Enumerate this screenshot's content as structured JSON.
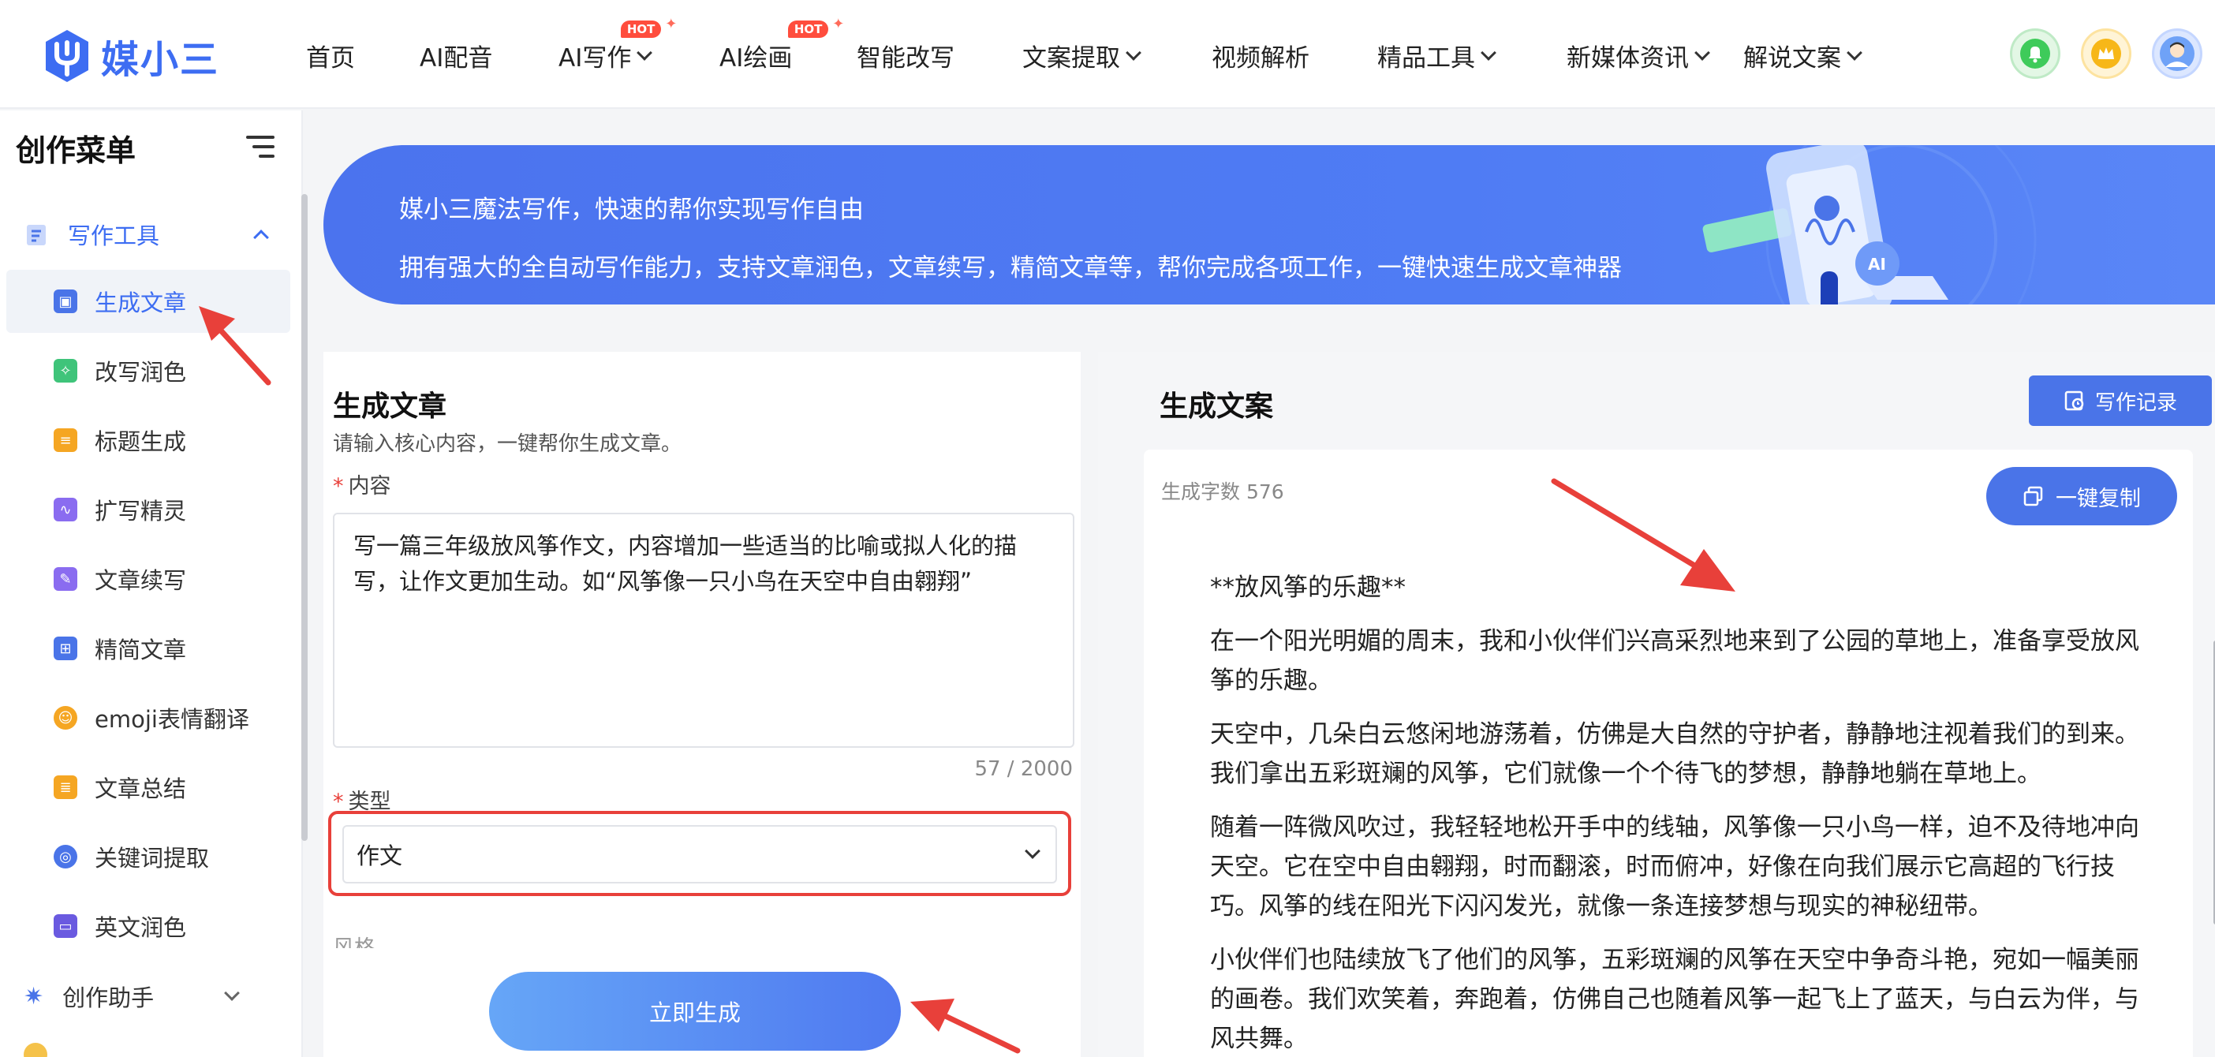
{
  "header": {
    "logo_text": "媒小三",
    "nav": [
      {
        "label": "首页"
      },
      {
        "label": "AI配音"
      },
      {
        "label": "AI写作",
        "dropdown": true,
        "badge": "HOT"
      },
      {
        "label": "AI绘画",
        "badge": "HOT"
      },
      {
        "label": "智能改写"
      },
      {
        "label": "文案提取",
        "dropdown": true
      },
      {
        "label": "视频解析"
      },
      {
        "label": "精品工具",
        "dropdown": true
      },
      {
        "label": "新媒体资讯",
        "dropdown": true
      },
      {
        "label": "解说文案",
        "dropdown": true
      }
    ],
    "icons": [
      "bell-icon",
      "crown-icon",
      "avatar"
    ]
  },
  "sidebar": {
    "title": "创作菜单",
    "group_writing": "写作工具",
    "items": [
      {
        "label": "生成文章",
        "icon": "generate-icon",
        "color": "#4a74e8"
      },
      {
        "label": "改写润色",
        "icon": "rewrite-icon",
        "color": "#3fc47a"
      },
      {
        "label": "标题生成",
        "icon": "title-icon",
        "color": "#f5a623"
      },
      {
        "label": "扩写精灵",
        "icon": "expand-icon",
        "color": "#8a6cf0"
      },
      {
        "label": "文章续写",
        "icon": "continue-icon",
        "color": "#8a6cf0"
      },
      {
        "label": "精简文章",
        "icon": "simplify-icon",
        "color": "#4a74e8"
      },
      {
        "label": "emoji表情翻译",
        "icon": "emoji-icon",
        "color": "#f5a623"
      },
      {
        "label": "文章总结",
        "icon": "summary-icon",
        "color": "#f5a623"
      },
      {
        "label": "关键词提取",
        "icon": "keyword-icon",
        "color": "#4a74e8"
      },
      {
        "label": "英文润色",
        "icon": "english-icon",
        "color": "#6a5ae0"
      }
    ],
    "group_assistant": "创作助手"
  },
  "banner": {
    "line1": "媒小三魔法写作，快速的帮你实现写作自由",
    "line2": "拥有强大的全自动写作能力，支持文章润色，文章续写，精简文章等，帮你完成各项工作，一键快速生成文章神器"
  },
  "form": {
    "title": "生成文章",
    "subtitle": "请输入核心内容，一键帮你生成文章。",
    "content_label": "内容",
    "content_value": "写一篇三年级放风筝作文，内容增加一些适当的比喻或拟人化的描写，让作文更加生动。如“风筝像一只小鸟在天空中自由翱翔”",
    "counter": "57 / 2000",
    "type_label": "类型",
    "type_value": "作文",
    "next_label": "风格",
    "generate_btn": "立即生成"
  },
  "result": {
    "title": "生成文案",
    "record_btn": "写作记录",
    "word_count": "生成字数 576",
    "copy_btn": "一键复制",
    "paragraphs": [
      "**放风筝的乐趣**",
      "在一个阳光明媚的周末，我和小伙伴们兴高采烈地来到了公园的草地上，准备享受放风筝的乐趣。",
      "天空中，几朵白云悠闲地游荡着，仿佛是大自然的守护者，静静地注视着我们的到来。我们拿出五彩斑斓的风筝，它们就像一个个待飞的梦想，静静地躺在草地上。",
      "随着一阵微风吹过，我轻轻地松开手中的线轴，风筝像一只小鸟一样，迫不及待地冲向天空。它在空中自由翱翔，时而翻滚，时而俯冲，好像在向我们展示它高超的飞行技巧。风筝的线在阳光下闪闪发光，就像一条连接梦想与现实的神秘纽带。",
      "小伙伴们也陆续放飞了他们的风筝，五彩斑斓的风筝在天空中争奇斗艳，宛如一幅美丽的画卷。我们欢笑着，奔跑着，仿佛自己也随着风筝一起飞上了蓝天，与白云为伴，与风共舞。"
    ]
  },
  "colors": {
    "accent": "#4a74e8",
    "annotation": "#e8403a"
  }
}
